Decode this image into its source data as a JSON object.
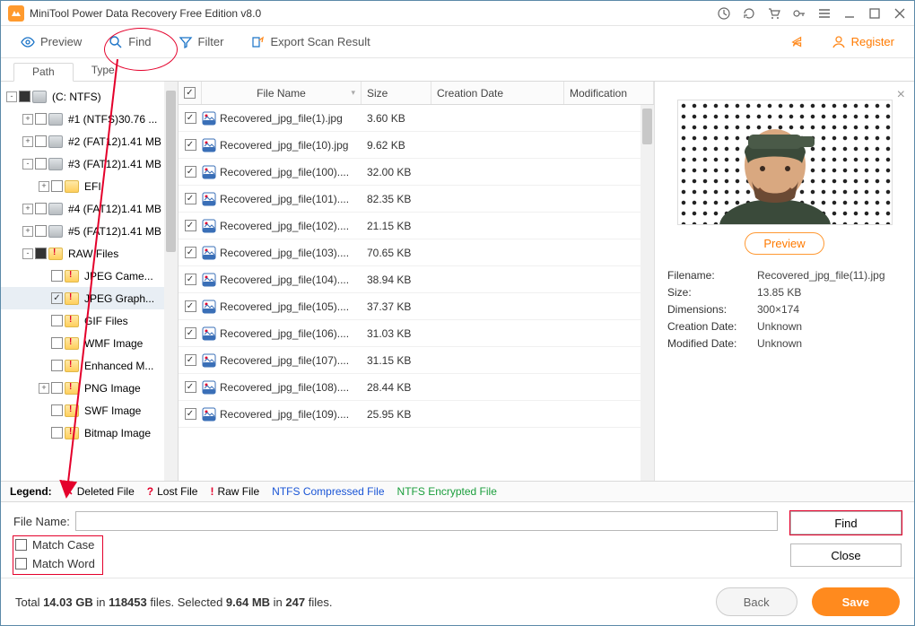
{
  "title": "MiniTool Power Data Recovery Free Edition v8.0",
  "toolbar": {
    "preview": "Preview",
    "find": "Find",
    "filter": "Filter",
    "export": "Export Scan Result",
    "register": "Register"
  },
  "tabs": {
    "path": "Path",
    "type": "Type"
  },
  "tree": [
    {
      "indent": 0,
      "exp": "-",
      "chk": "filled",
      "icon": "drive",
      "label": "(C: NTFS)"
    },
    {
      "indent": 1,
      "exp": "+",
      "chk": "none",
      "icon": "drive",
      "label": "#1 (NTFS)30.76 ..."
    },
    {
      "indent": 1,
      "exp": "+",
      "chk": "none",
      "icon": "drive",
      "label": "#2 (FAT12)1.41 MB"
    },
    {
      "indent": 1,
      "exp": "-",
      "chk": "none",
      "icon": "drive",
      "label": "#3 (FAT12)1.41 MB"
    },
    {
      "indent": 2,
      "exp": "+",
      "chk": "none",
      "icon": "folder",
      "label": "EFI"
    },
    {
      "indent": 1,
      "exp": "+",
      "chk": "none",
      "icon": "drive",
      "label": "#4 (FAT12)1.41 MB"
    },
    {
      "indent": 1,
      "exp": "+",
      "chk": "none",
      "icon": "drive",
      "label": "#5 (FAT12)1.41 MB"
    },
    {
      "indent": 1,
      "exp": "-",
      "chk": "filled",
      "icon": "folder-red",
      "label": "RAW Files"
    },
    {
      "indent": 2,
      "exp": "",
      "chk": "none",
      "icon": "folder-red",
      "label": "JPEG Came..."
    },
    {
      "indent": 2,
      "exp": "",
      "chk": "checked",
      "icon": "folder-red",
      "label": "JPEG Graph...",
      "sel": true
    },
    {
      "indent": 2,
      "exp": "",
      "chk": "none",
      "icon": "folder-red",
      "label": "GIF Files"
    },
    {
      "indent": 2,
      "exp": "",
      "chk": "none",
      "icon": "folder-red",
      "label": "WMF Image"
    },
    {
      "indent": 2,
      "exp": "",
      "chk": "none",
      "icon": "folder-red",
      "label": "Enhanced M..."
    },
    {
      "indent": 2,
      "exp": "+",
      "chk": "none",
      "icon": "folder-red",
      "label": "PNG Image"
    },
    {
      "indent": 2,
      "exp": "",
      "chk": "none",
      "icon": "folder-red",
      "label": "SWF Image"
    },
    {
      "indent": 2,
      "exp": "",
      "chk": "none",
      "icon": "folder-red",
      "label": "Bitmap Image"
    }
  ],
  "columns": {
    "name": "File Name",
    "size": "Size",
    "date": "Creation Date",
    "mod": "Modification"
  },
  "rows": [
    {
      "name": "Recovered_jpg_file(1).jpg",
      "size": "3.60 KB"
    },
    {
      "name": "Recovered_jpg_file(10).jpg",
      "size": "9.62 KB"
    },
    {
      "name": "Recovered_jpg_file(100)....",
      "size": "32.00 KB"
    },
    {
      "name": "Recovered_jpg_file(101)....",
      "size": "82.35 KB"
    },
    {
      "name": "Recovered_jpg_file(102)....",
      "size": "21.15 KB"
    },
    {
      "name": "Recovered_jpg_file(103)....",
      "size": "70.65 KB"
    },
    {
      "name": "Recovered_jpg_file(104)....",
      "size": "38.94 KB"
    },
    {
      "name": "Recovered_jpg_file(105)....",
      "size": "37.37 KB"
    },
    {
      "name": "Recovered_jpg_file(106)....",
      "size": "31.03 KB"
    },
    {
      "name": "Recovered_jpg_file(107)....",
      "size": "31.15 KB"
    },
    {
      "name": "Recovered_jpg_file(108)....",
      "size": "28.44 KB"
    },
    {
      "name": "Recovered_jpg_file(109)....",
      "size": "25.95 KB"
    }
  ],
  "preview": {
    "button": "Preview",
    "labels": {
      "fn": "Filename:",
      "sz": "Size:",
      "dim": "Dimensions:",
      "cd": "Creation Date:",
      "md": "Modified Date:"
    },
    "values": {
      "fn": "Recovered_jpg_file(11).jpg",
      "sz": "13.85 KB",
      "dim": "300×174",
      "cd": "Unknown",
      "md": "Unknown"
    }
  },
  "legend": {
    "title": "Legend:",
    "del": "Deleted File",
    "lost": "Lost File",
    "raw": "Raw File",
    "ntfsc": "NTFS Compressed File",
    "ntfse": "NTFS Encrypted File"
  },
  "find": {
    "label": "File Name:",
    "matchCase": "Match Case",
    "matchWord": "Match Word",
    "findBtn": "Find",
    "closeBtn": "Close"
  },
  "footer": {
    "t1": "Total ",
    "gb": "14.03 GB",
    "t2": " in ",
    "files": "118453",
    "t3": " files.  Selected ",
    "selmb": "9.64 MB",
    "t4": " in ",
    "selcount": "247",
    "t5": " files.",
    "back": "Back",
    "save": "Save"
  }
}
